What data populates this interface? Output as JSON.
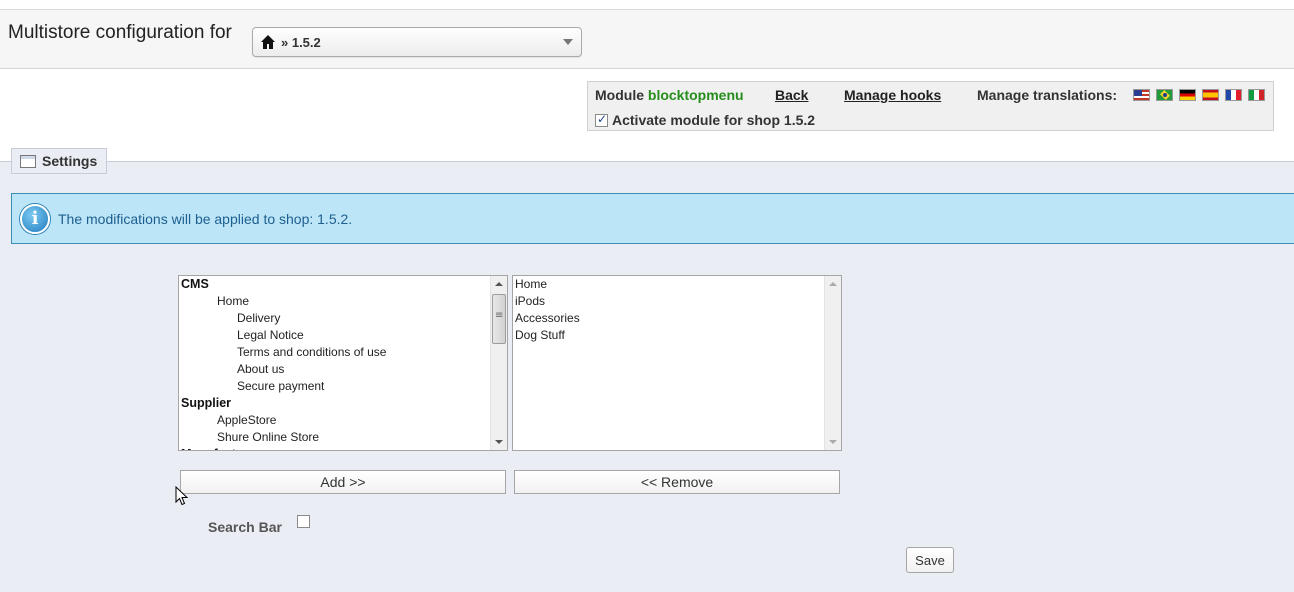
{
  "multistore": {
    "label": "Multistore configuration for",
    "selected_shop": "» 1.5.2",
    "icon": "home-icon"
  },
  "module_toolbar": {
    "module_prefix": "Module",
    "module_name": "blocktopmenu",
    "module_name_color": "#268d1c",
    "back_label": "Back",
    "manage_hooks_label": "Manage hooks",
    "manage_translations_label": "Manage translations:",
    "flags": [
      "us-flag",
      "br-flag",
      "de-flag",
      "es-flag",
      "fr-flag",
      "it-flag"
    ],
    "activate_label": "Activate module for shop 1.5.2",
    "activate_checked": true
  },
  "settings": {
    "legend": "Settings",
    "info_message": "The modifications will be applied to shop: 1.5.2.",
    "available_items": [
      {
        "label": "CMS",
        "type": "group"
      },
      {
        "label": "Home",
        "type": "l1"
      },
      {
        "label": "Delivery",
        "type": "l2"
      },
      {
        "label": "Legal Notice",
        "type": "l2"
      },
      {
        "label": "Terms and conditions of use",
        "type": "l2"
      },
      {
        "label": "About us",
        "type": "l2"
      },
      {
        "label": "Secure payment",
        "type": "l2"
      },
      {
        "label": "Supplier",
        "type": "group"
      },
      {
        "label": "AppleStore",
        "type": "l1"
      },
      {
        "label": "Shure Online Store",
        "type": "l1"
      },
      {
        "label": "Manufacturer",
        "type": "group"
      }
    ],
    "selected_items": [
      "Home",
      "iPods",
      "Accessories",
      "Dog Stuff"
    ],
    "add_button": "Add >>",
    "remove_button": "<< Remove",
    "search_bar_label": "Search Bar",
    "search_bar_checked": false,
    "save_button": "Save"
  }
}
